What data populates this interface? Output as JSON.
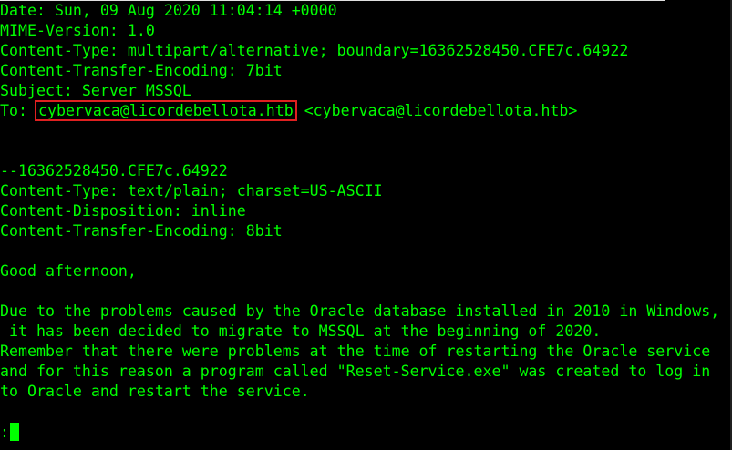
{
  "terminal": {
    "lines": {
      "date": "Date: Sun, 09 Aug 2020 11:04:14 +0000",
      "mime": "MIME-Version: 1.0",
      "content_type": "Content-Type: multipart/alternative; boundary=16362528450.CFE7c.64922",
      "cte": "Content-Transfer-Encoding: 7bit",
      "subject": "Subject: Server MSSQL",
      "to_prefix": "To: ",
      "to_highlighted": "cybervaca@licordebellota.htb",
      "to_suffix": " <cybervaca@licordebellota.htb>",
      "boundary": "--16362528450.CFE7c.64922",
      "part_ct": "Content-Type: text/plain; charset=US-ASCII",
      "part_cd": "Content-Disposition: inline",
      "part_cte": "Content-Transfer-Encoding: 8bit",
      "greeting": "Good afternoon,",
      "body1": "Due to the problems caused by the Oracle database installed in 2010 in Windows,",
      "body2": " it has been decided to migrate to MSSQL at the beginning of 2020.",
      "body3": "Remember that there were problems at the time of restarting the Oracle service",
      "body4": "and for this reason a program called \"Reset-Service.exe\" was created to log in",
      "body5": "to Oracle and restart the service."
    },
    "prompt": ":",
    "colors": {
      "background": "#000000",
      "text": "#00ff00",
      "highlight_box": "#e02020"
    }
  }
}
